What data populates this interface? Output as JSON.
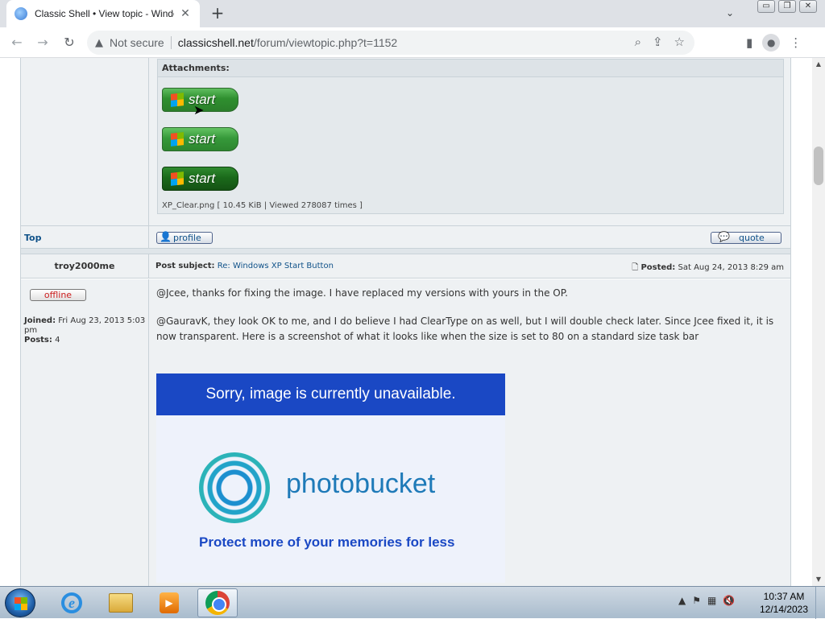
{
  "browser": {
    "tab_title": "Classic Shell • View topic - Windows XP Start Button",
    "tab_close": "✕",
    "new_tab": "+",
    "tab_search": "⌄",
    "window_buttons": [
      "▭",
      "❐",
      "✕"
    ],
    "back": "←",
    "forward": "→",
    "reload": "↻",
    "security_icon": "warning-triangle-icon",
    "security_label": "Not secure",
    "url_host": "classicshell.net",
    "url_path": "/forum/viewtopic.php?t=1152"
  },
  "attachments": {
    "header": "Attachments:",
    "start_label": "start",
    "caption": "XP_Clear.png [ 10.45 KiB | Viewed 278087 times ]"
  },
  "nav": {
    "top": "Top",
    "profile": "profile",
    "quote": "quote"
  },
  "post": {
    "author": "troy2000me",
    "subject_label": "Post subject:",
    "subject": "Re: Windows XP Start Button",
    "posted_label": "Posted:",
    "posted": "Sat Aug 24, 2013 8:29 am",
    "status": "offline",
    "joined_label": "Joined:",
    "joined": "Fri Aug 23, 2013 5:03 pm",
    "posts_label": "Posts:",
    "posts": "4",
    "paragraphs": [
      "@Jcee, thanks for fixing the image. I have replaced my versions with yours in the OP.",
      "@GauravK, they look OK to me, and I do believe I had ClearType on as well, but I will double check later. Since Jcee fixed it, it is now transparent. Here is a screenshot of what it looks like when the size is set to 80 on a standard size task bar"
    ]
  },
  "placeholder_image": {
    "banner": "Sorry, image is currently unavailable.",
    "brand": "photobucket",
    "tagline": "Protect more of your memories for less"
  },
  "taskbar": {
    "time": "10:37 AM",
    "date": "12/14/2023",
    "apps": [
      "internet-explorer",
      "windows-explorer",
      "media-player",
      "google-chrome"
    ]
  }
}
